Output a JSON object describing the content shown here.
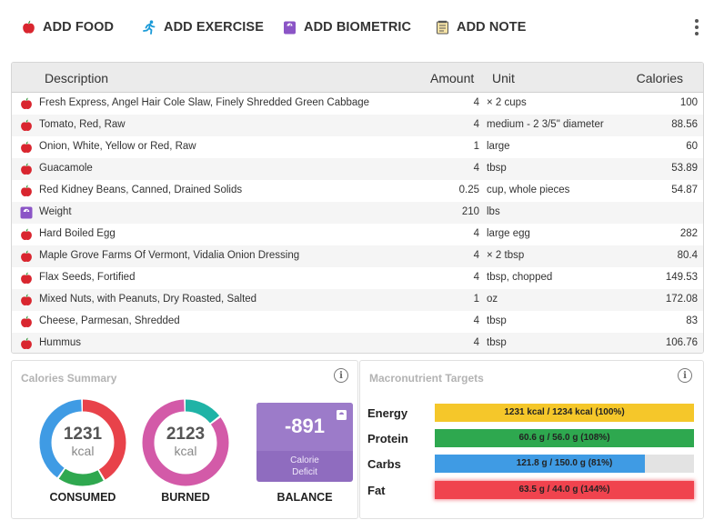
{
  "toolbar": {
    "items": [
      {
        "label": "ADD FOOD",
        "icon": "apple-icon"
      },
      {
        "label": "ADD EXERCISE",
        "icon": "running-icon"
      },
      {
        "label": "ADD BIOMETRIC",
        "icon": "scale-icon"
      },
      {
        "label": "ADD NOTE",
        "icon": "note-icon"
      }
    ],
    "more_icon": "kebab-menu-icon"
  },
  "table": {
    "headers": {
      "description": "Description",
      "amount": "Amount",
      "unit": "Unit",
      "calories": "Calories"
    },
    "rows": [
      {
        "icon": "apple-icon",
        "description": "Fresh Express, Angel Hair Cole Slaw, Finely Shredded Green Cabbage",
        "amount": "4",
        "unit": "× 2 cups",
        "calories": "100"
      },
      {
        "icon": "apple-icon",
        "description": "Tomato, Red, Raw",
        "amount": "4",
        "unit": "medium - 2 3/5\" diameter",
        "calories": "88.56"
      },
      {
        "icon": "apple-icon",
        "description": "Onion, White, Yellow or Red, Raw",
        "amount": "1",
        "unit": "large",
        "calories": "60"
      },
      {
        "icon": "apple-icon",
        "description": "Guacamole",
        "amount": "4",
        "unit": "tbsp",
        "calories": "53.89"
      },
      {
        "icon": "apple-icon",
        "description": "Red Kidney Beans, Canned, Drained Solids",
        "amount": "0.25",
        "unit": "cup, whole pieces",
        "calories": "54.87"
      },
      {
        "icon": "scale-icon",
        "description": "Weight",
        "amount": "210",
        "unit": "lbs",
        "calories": ""
      },
      {
        "icon": "apple-icon",
        "description": "Hard Boiled Egg",
        "amount": "4",
        "unit": "large egg",
        "calories": "282"
      },
      {
        "icon": "apple-icon",
        "description": "Maple Grove Farms Of Vermont, Vidalia Onion Dressing",
        "amount": "4",
        "unit": "× 2 tbsp",
        "calories": "80.4"
      },
      {
        "icon": "apple-icon",
        "description": "Flax Seeds, Fortified",
        "amount": "4",
        "unit": "tbsp, chopped",
        "calories": "149.53"
      },
      {
        "icon": "apple-icon",
        "description": "Mixed Nuts, with Peanuts, Dry Roasted, Salted",
        "amount": "1",
        "unit": "oz",
        "calories": "172.08"
      },
      {
        "icon": "apple-icon",
        "description": "Cheese, Parmesan, Shredded",
        "amount": "4",
        "unit": "tbsp",
        "calories": "83"
      },
      {
        "icon": "apple-icon",
        "description": "Hummus",
        "amount": "4",
        "unit": "tbsp",
        "calories": "106.76"
      }
    ]
  },
  "calories_summary": {
    "title": "Calories Summary",
    "consumed": {
      "value": "1231",
      "unit": "kcal",
      "caption": "CONSUMED",
      "segments": [
        {
          "color": "#e8424a",
          "fraction": 0.42
        },
        {
          "color": "#2fa84f",
          "fraction": 0.18
        },
        {
          "color": "#3f9be4",
          "fraction": 0.4
        }
      ]
    },
    "burned": {
      "value": "2123",
      "unit": "kcal",
      "caption": "BURNED",
      "segments": [
        {
          "color": "#1fb3a6",
          "fraction": 0.15
        },
        {
          "color": "#d35aa8",
          "fraction": 0.85
        }
      ]
    },
    "balance": {
      "value": "-891",
      "label_line1": "Calorie",
      "label_line2": "Deficit",
      "caption": "BALANCE"
    }
  },
  "macronutrient_targets": {
    "title": "Macronutrient Targets",
    "rows": [
      {
        "label": "Energy",
        "text": "1231 kcal / 1234 kcal (100%)",
        "percent": 100,
        "color": "#f5c72a"
      },
      {
        "label": "Protein",
        "text": "60.6 g / 56.0 g (108%)",
        "percent": 100,
        "color": "#2ea84f"
      },
      {
        "label": "Carbs",
        "text": "121.8 g / 150.0 g (81%)",
        "percent": 81,
        "color": "#3f9be4"
      },
      {
        "label": "Fat",
        "text": "63.5 g / 44.0 g (144%)",
        "percent": 100,
        "color": "#f0434e"
      }
    ]
  },
  "colors": {
    "apple": "#d9262f",
    "leaf": "#3a9a3f",
    "biometric": "#8b55c6",
    "exercise": "#1b9bd8"
  }
}
